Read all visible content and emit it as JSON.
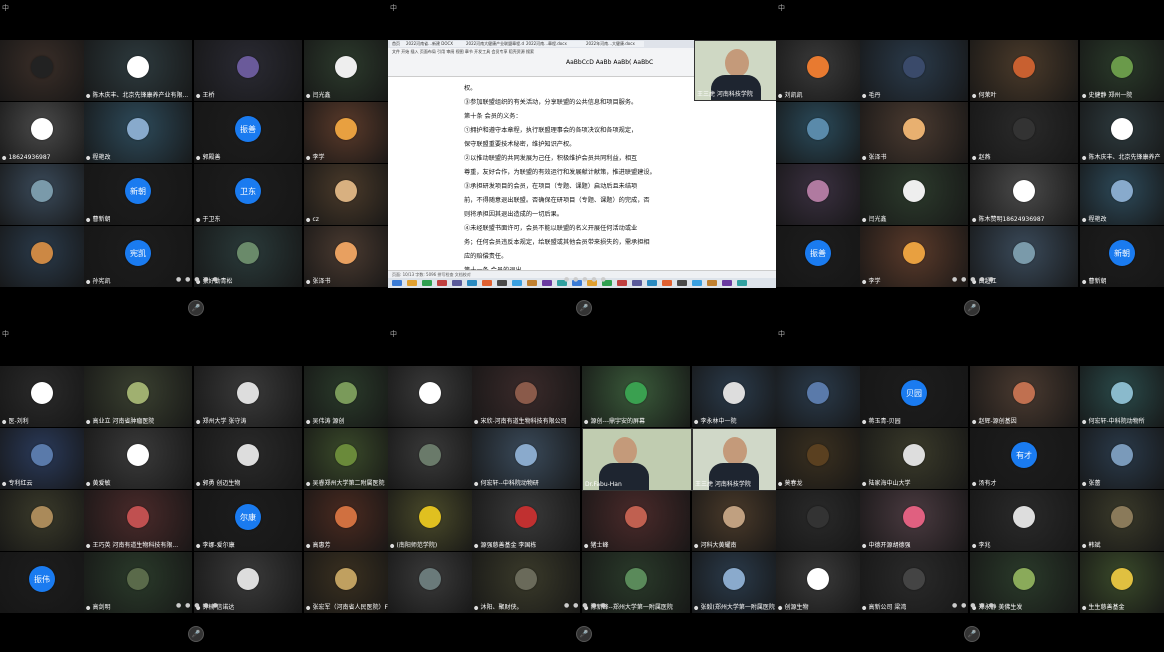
{
  "panels": [
    {
      "id": "p1",
      "top_label": "中",
      "tiles": [
        {
          "label": "",
          "avatar_text": "",
          "bg": "#3a2e28",
          "av": "#222"
        },
        {
          "label": "陈木庆丰、北京先锋康养产业有限...",
          "avatar_text": "",
          "bg": "#2d3a3e",
          "av": "#fff"
        },
        {
          "label": "王桥",
          "avatar_text": "",
          "bg": "#2a2a33",
          "av": "#6a5a9a"
        },
        {
          "label": "闫光鑫",
          "avatar_text": "",
          "bg": "#2c3a2c",
          "av": "#eee"
        },
        {
          "label": "18624936987",
          "avatar_text": "",
          "bg": "#4a4a4a",
          "av": "#fff"
        },
        {
          "label": "程艳改",
          "avatar_text": "",
          "bg": "#2d4a5a",
          "av": "#8ac"
        },
        {
          "label": "郭殿善",
          "avatar_text": "振善",
          "bg": "#1d1d1d",
          "av": "#1a7bf0"
        },
        {
          "label": "李学",
          "avatar_text": "",
          "bg": "#5a3a2a",
          "av": "#e8a040"
        },
        {
          "label": "",
          "avatar_text": "",
          "bg": "#3a4a5a",
          "av": "#7a9aaa"
        },
        {
          "label": "曹新朝",
          "avatar_text": "新朝",
          "bg": "#1d1d1d",
          "av": "#1a7bf0"
        },
        {
          "label": "于卫东",
          "avatar_text": "卫东",
          "bg": "#1d1d1d",
          "av": "#1a7bf0"
        },
        {
          "label": "cz",
          "avatar_text": "",
          "bg": "#4a3a2a",
          "av": "#d8b080"
        },
        {
          "label": "",
          "avatar_text": "",
          "bg": "#2a3a4a",
          "av": "#c84"
        },
        {
          "label": "孙宪凯",
          "avatar_text": "宪凯",
          "bg": "#1d1d1d",
          "av": "#1a7bf0"
        },
        {
          "label": "张好勤青松",
          "avatar_text": "",
          "bg": "#2a3a3a",
          "av": "#6a8a6a"
        },
        {
          "label": "张泽书",
          "avatar_text": "",
          "bg": "#4a3a30",
          "av": "#e8a060"
        }
      ]
    },
    {
      "id": "p2",
      "top_label": "中",
      "share": {
        "tabs": [
          "首页",
          "2022河南省...新建 DOCX",
          "2022河南大健康产业联盟章程.docx",
          "2022河南...章程.docx",
          "2022年河南...大健康.docx"
        ],
        "menu": "文件  开始  插入  页面布局  引用  审阅  视图  章节  开发工具  会员专享  稻壳资源  搜索",
        "styles": "AaBbCcD  AaBb  AaBb(  AaBbC",
        "doc_lines": [
          "权。",
          "③参加联盟组织的有关活动，分享联盟的公共信息和项目服务。",
          "第十条  会员的义务：",
          "①拥护和遵守本章程，执行联盟理事会的各项决议和各项规定，",
          "保守联盟重要技术秘密，维护知识产权。",
          "②以推动联盟的共同发展为己任，积极维护会员共同利益，相互",
          "尊重，友好合作，为联盟的有效运行和发展献计献策，推进联盟建设。",
          "③承担研发项目的会员，在项目（专题、课题）启动后且未结项",
          "前，不得随意退出联盟。否确保在研项目（专题、课题）的完成，否",
          "则将承担因其退出造成的一切后果。",
          "④未经联盟书面许可，会员不能以联盟的名义开展任何活动或业",
          "务；任何会员违反本规定，给联盟或其他会员带来损失的，需承担相",
          "应的赔偿责任。",
          "第十一条  会员的退出"
        ],
        "status": "页面: 10/13  字数: 5096  拼写检查  文档校对"
      },
      "pip": {
        "label": "王三虎 河南科技学院"
      }
    },
    {
      "id": "p3",
      "top_label": "中",
      "tiles": [
        {
          "label": "刘凯凯",
          "avatar_text": "",
          "bg": "#3a3a3a",
          "av": "#e87a30"
        },
        {
          "label": "毛丹",
          "avatar_text": "",
          "bg": "#2a3a4a",
          "av": "#3a4a6a"
        },
        {
          "label": "何茉叶",
          "avatar_text": "",
          "bg": "#4a3a2a",
          "av": "#c86030"
        },
        {
          "label": "史健静  郑州一院",
          "avatar_text": "",
          "bg": "#2a3a2a",
          "av": "#6a9a4a"
        },
        {
          "label": "",
          "avatar_text": "",
          "bg": "#2a4a5a",
          "av": "#5a8aaa"
        },
        {
          "label": "张泽书",
          "avatar_text": "",
          "bg": "#4a3a30",
          "av": "#e8b070"
        },
        {
          "label": "赵燕",
          "avatar_text": "",
          "bg": "#2a2a2a",
          "av": "#333"
        },
        {
          "label": "陈木庆丰、北京先锋康养产",
          "avatar_text": "",
          "bg": "#2d3a3e",
          "av": "#fff"
        },
        {
          "label": "",
          "avatar_text": "",
          "bg": "#3a3040",
          "av": "#b07aa0"
        },
        {
          "label": "闫光鑫",
          "avatar_text": "",
          "bg": "#2c3a2c",
          "av": "#eee"
        },
        {
          "label": "陈木赞明18624936987",
          "avatar_text": "",
          "bg": "#4a4a4a",
          "av": "#fff"
        },
        {
          "label": "程艳改",
          "avatar_text": "",
          "bg": "#2d4a5a",
          "av": "#8ac"
        },
        {
          "label": "",
          "avatar_text": "振善",
          "bg": "#1d1d1d",
          "av": "#1a7bf0"
        },
        {
          "label": "李学",
          "avatar_text": "",
          "bg": "#5a3a2a",
          "av": "#e8a040"
        },
        {
          "label": "白超江",
          "avatar_text": "",
          "bg": "#3a4a5a",
          "av": "#7a9aaa"
        },
        {
          "label": "曹新朝",
          "avatar_text": "新朝",
          "bg": "#1d1d1d",
          "av": "#1a7bf0"
        }
      ]
    },
    {
      "id": "p4",
      "top_label": "中",
      "tiles": [
        {
          "label": "医-刘利",
          "avatar_text": "",
          "bg": "#2a2a2a",
          "av": "#fff"
        },
        {
          "label": "高业立  河南省肿瘤医院",
          "avatar_text": "",
          "bg": "#3a4030",
          "av": "#a0b070"
        },
        {
          "label": "郑州大学  张守涛",
          "avatar_text": "",
          "bg": "#3a3a3a",
          "av": "#ddd"
        },
        {
          "label": "吴伟涛  源创",
          "avatar_text": "",
          "bg": "#2a3a2a",
          "av": "#7a9a5a"
        },
        {
          "label": "专利红云",
          "avatar_text": "",
          "bg": "#2a3a5a",
          "av": "#5a7aaa"
        },
        {
          "label": "黄爱敏",
          "avatar_text": "",
          "bg": "#3a3a3a",
          "av": "#fff"
        },
        {
          "label": "郭勇  创迈生物",
          "avatar_text": "",
          "bg": "#2a2a2a",
          "av": "#ddd"
        },
        {
          "label": "吴睿郑州大学第二附属医院",
          "avatar_text": "",
          "bg": "#3a4a2a",
          "av": "#6a8a3a"
        },
        {
          "label": "",
          "avatar_text": "",
          "bg": "#3a3a2a",
          "av": "#aa8a5a"
        },
        {
          "label": "王巧英  河南有道生物科技有限...",
          "avatar_text": "",
          "bg": "#4a2a2a",
          "av": "#c05050"
        },
        {
          "label": "李娜-爱尔康",
          "avatar_text": "尔康",
          "bg": "#1d1d1d",
          "av": "#1a7bf0"
        },
        {
          "label": "高惠芳",
          "avatar_text": "",
          "bg": "#4a2a20",
          "av": "#d07040"
        },
        {
          "label": "",
          "avatar_text": "振伟",
          "bg": "#1d1d1d",
          "av": "#1a7bf0"
        },
        {
          "label": "高剑明",
          "avatar_text": "",
          "bg": "#2a3a2a",
          "av": "#5a6a4a"
        },
        {
          "label": "钟楠  信诺达",
          "avatar_text": "",
          "bg": "#3a3a3a",
          "av": "#ddd"
        },
        {
          "label": "张宏军（河南省人民医院）F",
          "avatar_text": "",
          "bg": "#3a3020",
          "av": "#c0a060"
        }
      ]
    },
    {
      "id": "p5",
      "top_label": "中",
      "tiles": [
        {
          "label": "",
          "avatar_text": "",
          "bg": "#3a3a3a",
          "av": "#fff"
        },
        {
          "label": "宋欣-河南有道生物科技有限公司",
          "avatar_text": "",
          "bg": "#3a2a2a",
          "av": "#8a5a4a"
        },
        {
          "label": "源创---鼎宇安的屏幕",
          "avatar_text": "",
          "bg": "#3a5a3a",
          "av": "#3aa050"
        },
        {
          "label": "李永林中一院",
          "avatar_text": "",
          "bg": "#2a3a4a",
          "av": "#ddd"
        },
        {
          "label": "",
          "avatar_text": "",
          "bg": "#3a3a3a",
          "av": "#6a7a6a"
        },
        {
          "label": "何宏轩--中科院动物研",
          "avatar_text": "",
          "bg": "#3a4a5a",
          "av": "#8aaacc"
        },
        {
          "label": "",
          "avatar_text": "",
          "bg": "",
          "av": ""
        },
        {
          "label": "",
          "avatar_text": "",
          "bg": "",
          "av": ""
        },
        {
          "label": "(南阳师范学院)",
          "avatar_text": "",
          "bg": "#4a4a2a",
          "av": "#e0c020"
        },
        {
          "label": "源强慈善基金  李国栋",
          "avatar_text": "",
          "bg": "#3a3a3a",
          "av": "#c03030"
        },
        {
          "label": "猪士峰",
          "avatar_text": "",
          "bg": "#4a2a2a",
          "av": "#c06050"
        },
        {
          "label": "河科大黄耀南",
          "avatar_text": "",
          "bg": "#4a3a2a",
          "av": "#c0a080"
        },
        {
          "label": "",
          "avatar_text": "",
          "bg": "#3a3a3a",
          "av": "#6a7a7a"
        },
        {
          "label": "沐阳、聚财侠。",
          "avatar_text": "",
          "bg": "#3a3a2a",
          "av": "#6a6a5a"
        },
        {
          "label": "陈新峰--郑州大学第一附属医院",
          "avatar_text": "",
          "bg": "#2a3a2a",
          "av": "#5a8a5a"
        },
        {
          "label": "张毅(郑州大学第一附属医院",
          "avatar_text": "",
          "bg": "#2a3a4a",
          "av": "#8aaacc"
        }
      ],
      "pips": [
        {
          "label": "Dr.Fabu-Han",
          "bg": "#c0ccb0"
        },
        {
          "label": "王三虎 河南科技学院",
          "bg": "#d0d8c8"
        }
      ]
    },
    {
      "id": "p6",
      "top_label": "中",
      "tiles": [
        {
          "label": "",
          "avatar_text": "",
          "bg": "#2a3a4a",
          "av": "#5a7aaa"
        },
        {
          "label": "蒋玉青-贝园",
          "avatar_text": "贝园",
          "bg": "#1d1d1d",
          "av": "#1a7bf0"
        },
        {
          "label": "赵辉-源创基因",
          "avatar_text": "",
          "bg": "#4a3a30",
          "av": "#c07050"
        },
        {
          "label": "何宏轩-中科院动物所",
          "avatar_text": "",
          "bg": "#2a4a4a",
          "av": "#8abacc"
        },
        {
          "label": "莫春龙",
          "avatar_text": "",
          "bg": "#3a3020",
          "av": "#5a4020"
        },
        {
          "label": "陆家海中山大学",
          "avatar_text": "",
          "bg": "#3a3a2a",
          "av": "#ddd"
        },
        {
          "label": "汤有才",
          "avatar_text": "有才",
          "bg": "#1d1d1d",
          "av": "#1a7bf0"
        },
        {
          "label": "张蕾",
          "avatar_text": "",
          "bg": "#2a3a4a",
          "av": "#7a9aba"
        },
        {
          "label": "",
          "avatar_text": "",
          "bg": "#2a2a2a",
          "av": "#333"
        },
        {
          "label": "中德开源胡德强",
          "avatar_text": "",
          "bg": "#4a3a40",
          "av": "#e06080"
        },
        {
          "label": "李兆",
          "avatar_text": "",
          "bg": "#2a2a2a",
          "av": "#ddd"
        },
        {
          "label": "韩斌",
          "avatar_text": "",
          "bg": "#3a3a2a",
          "av": "#8a7a5a"
        },
        {
          "label": "创源生物",
          "avatar_text": "",
          "bg": "#3a3a3a",
          "av": "#fff"
        },
        {
          "label": "高新公司  梁湾",
          "avatar_text": "",
          "bg": "#2a2a2a",
          "av": "#444"
        },
        {
          "label": "郑永静  美佛生发",
          "avatar_text": "",
          "bg": "#2a3a2a",
          "av": "#8aaa5a"
        },
        {
          "label": "生生慈善基金",
          "avatar_text": "",
          "bg": "#3a4a2a",
          "av": "#e0c040"
        }
      ]
    }
  ],
  "dots": "● ● ● ● ●",
  "mic_glyph": "🎤"
}
